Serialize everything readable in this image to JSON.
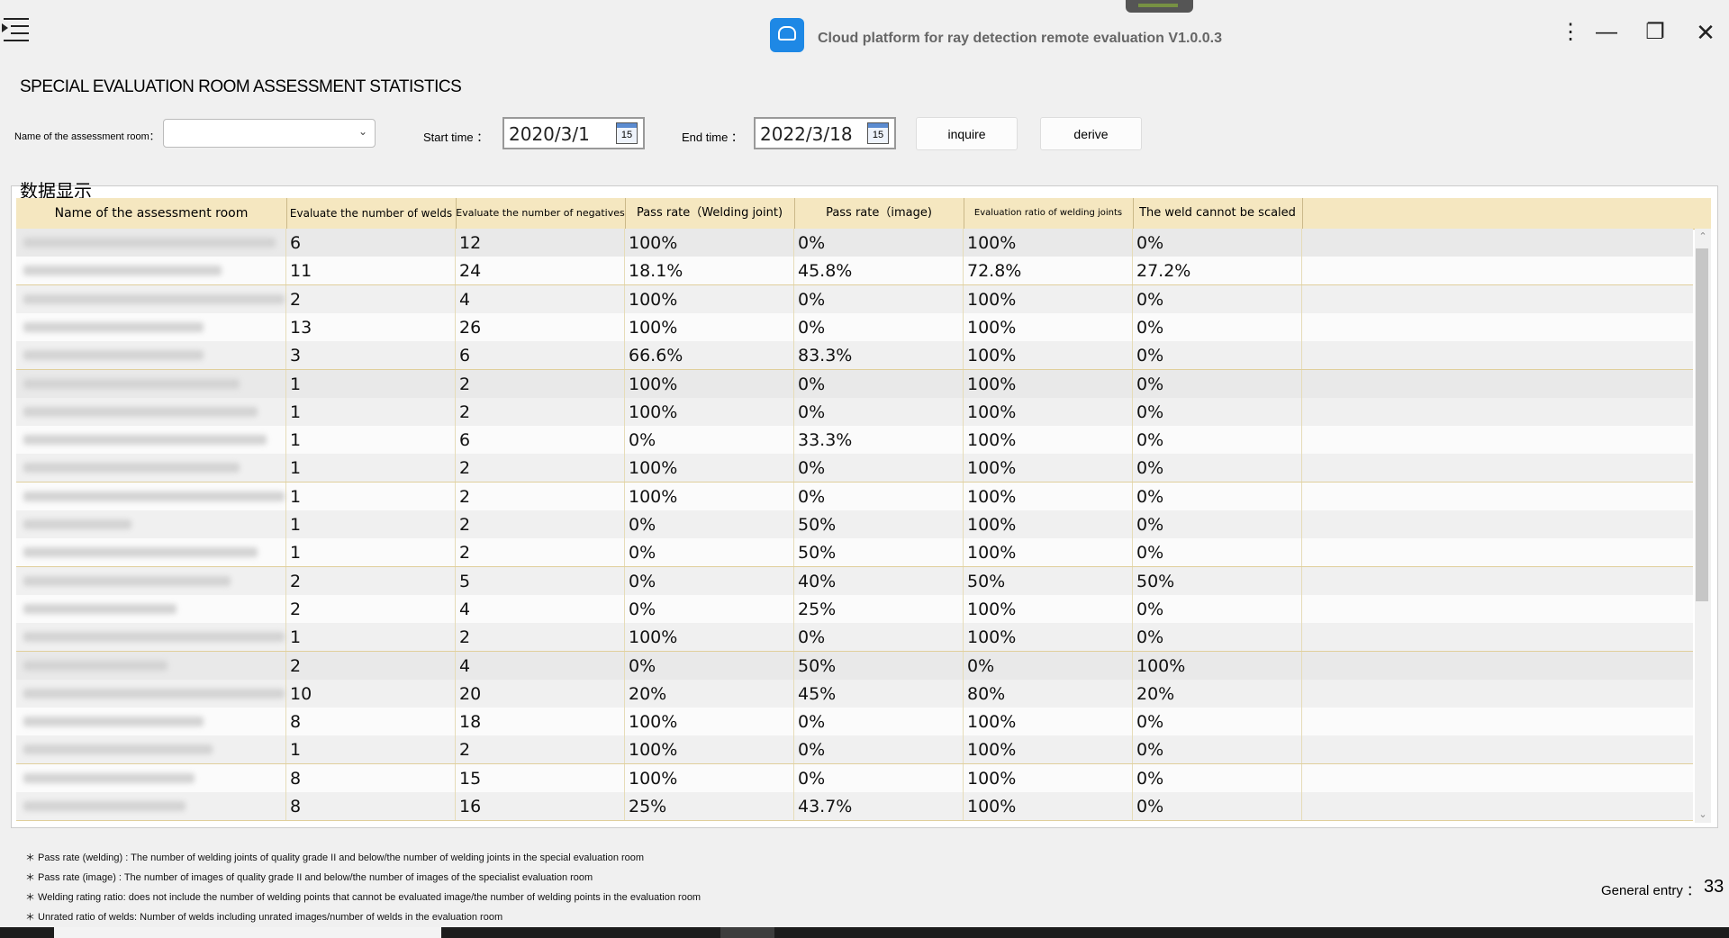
{
  "window": {
    "title": "Cloud platform for ray detection remote evaluation V1.0.0.3",
    "more_glyph": "⋮",
    "minimize_glyph": "—",
    "restore_glyph": "❐",
    "close_glyph": "✕"
  },
  "page": {
    "title": "SPECIAL EVALUATION ROOM ASSESSMENT STATISTICS"
  },
  "filters": {
    "room_label": "Name of the assessment room：",
    "room_value": "",
    "start_label": "Start time ：",
    "start_value": "2020/3/1",
    "end_label": "End time ：",
    "end_value": "2022/3/18",
    "calendar_day": "15",
    "inquire_label": "inquire",
    "derive_label": "derive"
  },
  "group": {
    "label": "数据显示"
  },
  "table": {
    "headers": [
      "Name of the assessment room",
      "Evaluate the number of welds",
      "Evaluate the number of negatives",
      "Pass rate（Welding joint)",
      "Pass rate（image)",
      "Evaluation ratio of welding joints",
      "The weld cannot be scaled"
    ],
    "rows": [
      [
        "",
        "6",
        "12",
        "100%",
        "0%",
        "100%",
        "0%"
      ],
      [
        "",
        "11",
        "24",
        "18.1%",
        "45.8%",
        "72.8%",
        "27.2%"
      ],
      [
        "",
        "2",
        "4",
        "100%",
        "0%",
        "100%",
        "0%"
      ],
      [
        "",
        "13",
        "26",
        "100%",
        "0%",
        "100%",
        "0%"
      ],
      [
        "",
        "3",
        "6",
        "66.6%",
        "83.3%",
        "100%",
        "0%"
      ],
      [
        "",
        "1",
        "2",
        "100%",
        "0%",
        "100%",
        "0%"
      ],
      [
        "",
        "1",
        "2",
        "100%",
        "0%",
        "100%",
        "0%"
      ],
      [
        "",
        "1",
        "6",
        "0%",
        "33.3%",
        "100%",
        "0%"
      ],
      [
        "",
        "1",
        "2",
        "100%",
        "0%",
        "100%",
        "0%"
      ],
      [
        "",
        "1",
        "2",
        "100%",
        "0%",
        "100%",
        "0%"
      ],
      [
        "",
        "1",
        "2",
        "0%",
        "50%",
        "100%",
        "0%"
      ],
      [
        "",
        "1",
        "2",
        "0%",
        "50%",
        "100%",
        "0%"
      ],
      [
        "",
        "2",
        "5",
        "0%",
        "40%",
        "50%",
        "50%"
      ],
      [
        "",
        "2",
        "4",
        "0%",
        "25%",
        "100%",
        "0%"
      ],
      [
        "",
        "1",
        "2",
        "100%",
        "0%",
        "100%",
        "0%"
      ],
      [
        "",
        "2",
        "4",
        "0%",
        "50%",
        "0%",
        "100%"
      ],
      [
        "",
        "10",
        "20",
        "20%",
        "45%",
        "80%",
        "20%"
      ],
      [
        "",
        "8",
        "18",
        "100%",
        "0%",
        "100%",
        "0%"
      ],
      [
        "",
        "1",
        "2",
        "100%",
        "0%",
        "100%",
        "0%"
      ],
      [
        "",
        "8",
        "15",
        "100%",
        "0%",
        "100%",
        "0%"
      ],
      [
        "",
        "8",
        "16",
        "25%",
        "43.7%",
        "100%",
        "0%"
      ]
    ]
  },
  "notes": [
    "＊ Pass rate (welding) : The number of welding joints of quality grade II and below/the number of welding joints in the special evaluation room",
    "＊ Pass rate (image) : The number of images of quality grade II and below/the number of images of the specialist evaluation room",
    "＊ Welding rating ratio: does not include the number of welding points that cannot be evaluated image/the number of welding points in the evaluation room",
    "＊ Unrated ratio of welds: Number of welds including unrated images/number of welds in the evaluation room"
  ],
  "footer": {
    "entry_label": "General entry ：",
    "entry_count": "33"
  },
  "colors": {
    "header_bg": "#f5e7c0",
    "accent": "#1e88e5"
  },
  "icons": [
    "menu-icon",
    "app-logo-icon",
    "more-icon",
    "minimize-icon",
    "restore-icon",
    "close-icon",
    "calendar-icon",
    "chevron-down-icon"
  ]
}
